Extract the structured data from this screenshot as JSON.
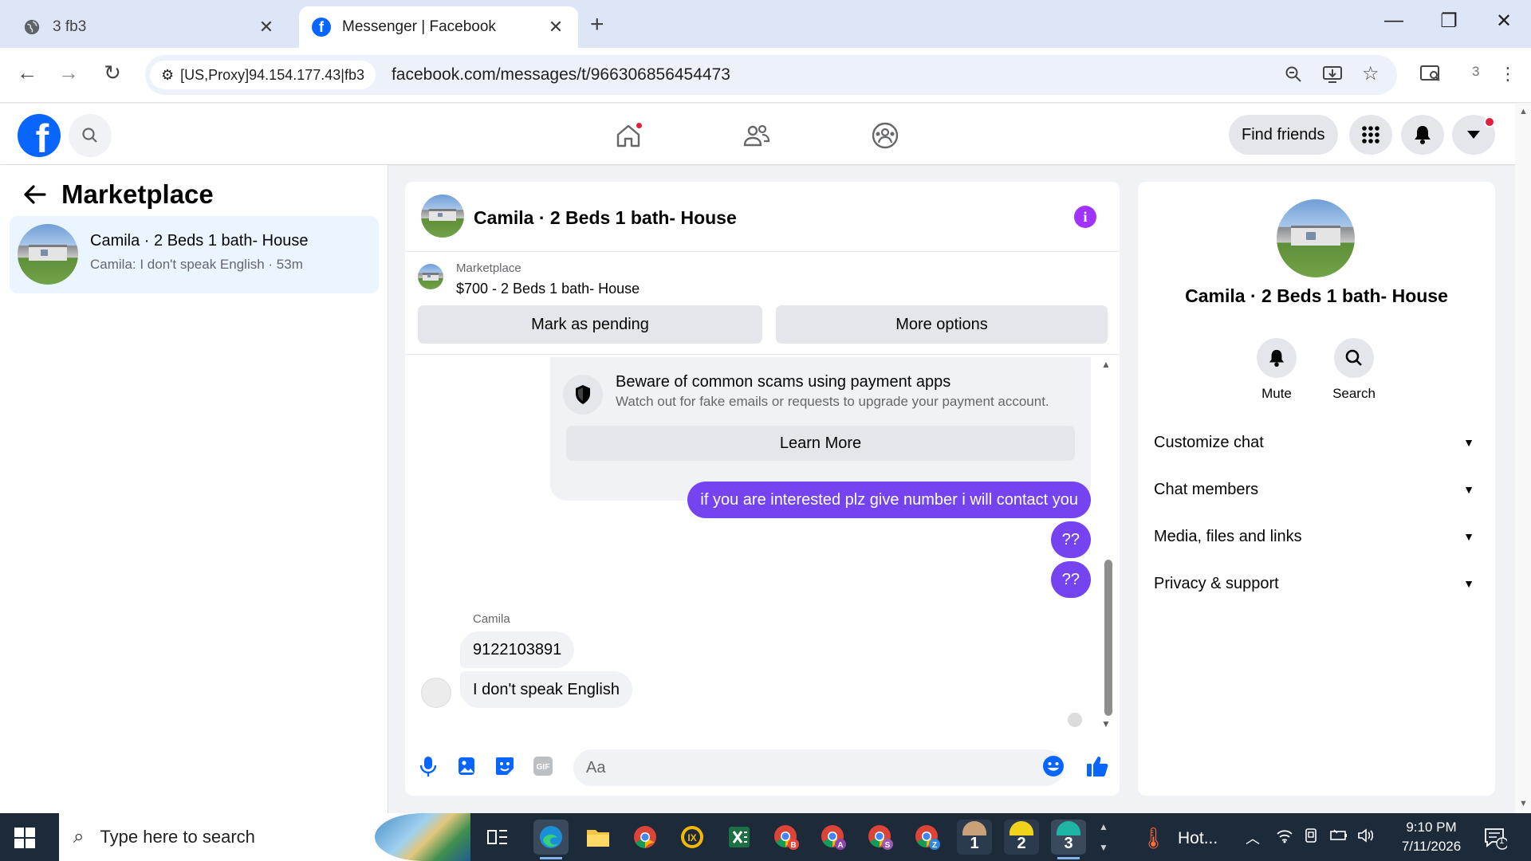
{
  "browser": {
    "tabs": [
      {
        "title": "3 fb3"
      },
      {
        "title": "Messenger | Facebook"
      }
    ],
    "site_info": "[US,Proxy]94.154.177.43|fb3",
    "url": "facebook.com/messages/t/966306856454473",
    "profile_count": "3"
  },
  "fb_header": {
    "logo_letter": "f",
    "find_friends": "Find friends"
  },
  "left_panel": {
    "title": "Marketplace",
    "conversation": {
      "name": "Camila · 2 Beds 1 bath- House",
      "preview": "Camila: I don't speak English · 53m"
    }
  },
  "chat": {
    "title": "Camila · 2 Beds 1 bath- House",
    "marketplace_label": "Marketplace",
    "listing": "$700 - 2 Beds 1 bath- House",
    "mark_pending": "Mark as pending",
    "more_options": "More options",
    "scam_notice": {
      "title": "Beware of common scams using payment apps",
      "subtitle": "Watch out for fake emails or requests to upgrade your payment account.",
      "button": "Learn More"
    },
    "messages_out": [
      "if you are interested plz give number i will contact you",
      "??",
      "??"
    ],
    "sender_name": "Camila",
    "messages_in": [
      "9122103891",
      "I don't speak English"
    ],
    "input_placeholder": "Aa",
    "icons": [
      "microphone-icon",
      "photo-icon",
      "sticker-icon",
      "gif-icon",
      "emoji-icon",
      "thumbs-up-icon"
    ]
  },
  "right_panel": {
    "title": "Camila · 2 Beds 1 bath- House",
    "actions": [
      {
        "label": "Mute",
        "icon": "bell-icon"
      },
      {
        "label": "Search",
        "icon": "search-icon"
      }
    ],
    "sections": [
      "Customize chat",
      "Chat members",
      "Media, files and links",
      "Privacy & support"
    ]
  },
  "taskbar": {
    "search_placeholder": "Type here to search",
    "weather": "Hot...",
    "time": "9:10 PM",
    "date": "7/11/2026",
    "notification_count": "1",
    "app_badges": [
      "1",
      "2",
      "3"
    ]
  },
  "colors": {
    "fb_blue": "#0866ff",
    "messenger_purple": "#7544f0",
    "info_purple": "#a033ff",
    "selected_conv": "#ebf5ff"
  }
}
